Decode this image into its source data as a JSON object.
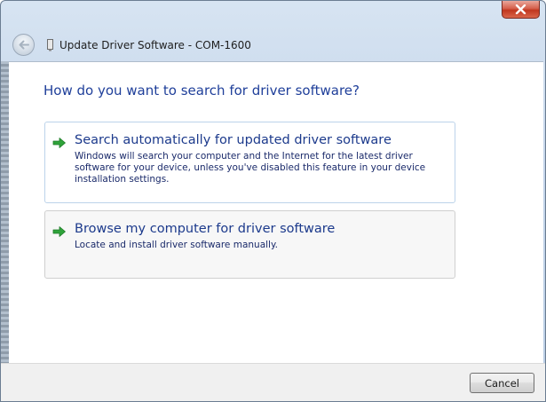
{
  "window": {
    "title": "Update Driver Software - COM-1600",
    "icons": {
      "close": "close-icon",
      "back": "back-arrow-icon",
      "device": "device-icon"
    }
  },
  "main": {
    "heading": "How do you want to search for driver software?",
    "options": [
      {
        "icon": "green-arrow-icon",
        "title": "Search automatically for updated driver software",
        "description": "Windows will search your computer and the Internet for the latest driver software for your device, unless you've disabled this feature in your device installation settings."
      },
      {
        "icon": "green-arrow-icon",
        "title": "Browse my computer for driver software",
        "description": "Locate and install driver software manually."
      }
    ]
  },
  "footer": {
    "cancel_label": "Cancel"
  },
  "colors": {
    "link_blue": "#1c3a8c",
    "arrow_green": "#2fa33a",
    "close_red": "#c0361f"
  }
}
